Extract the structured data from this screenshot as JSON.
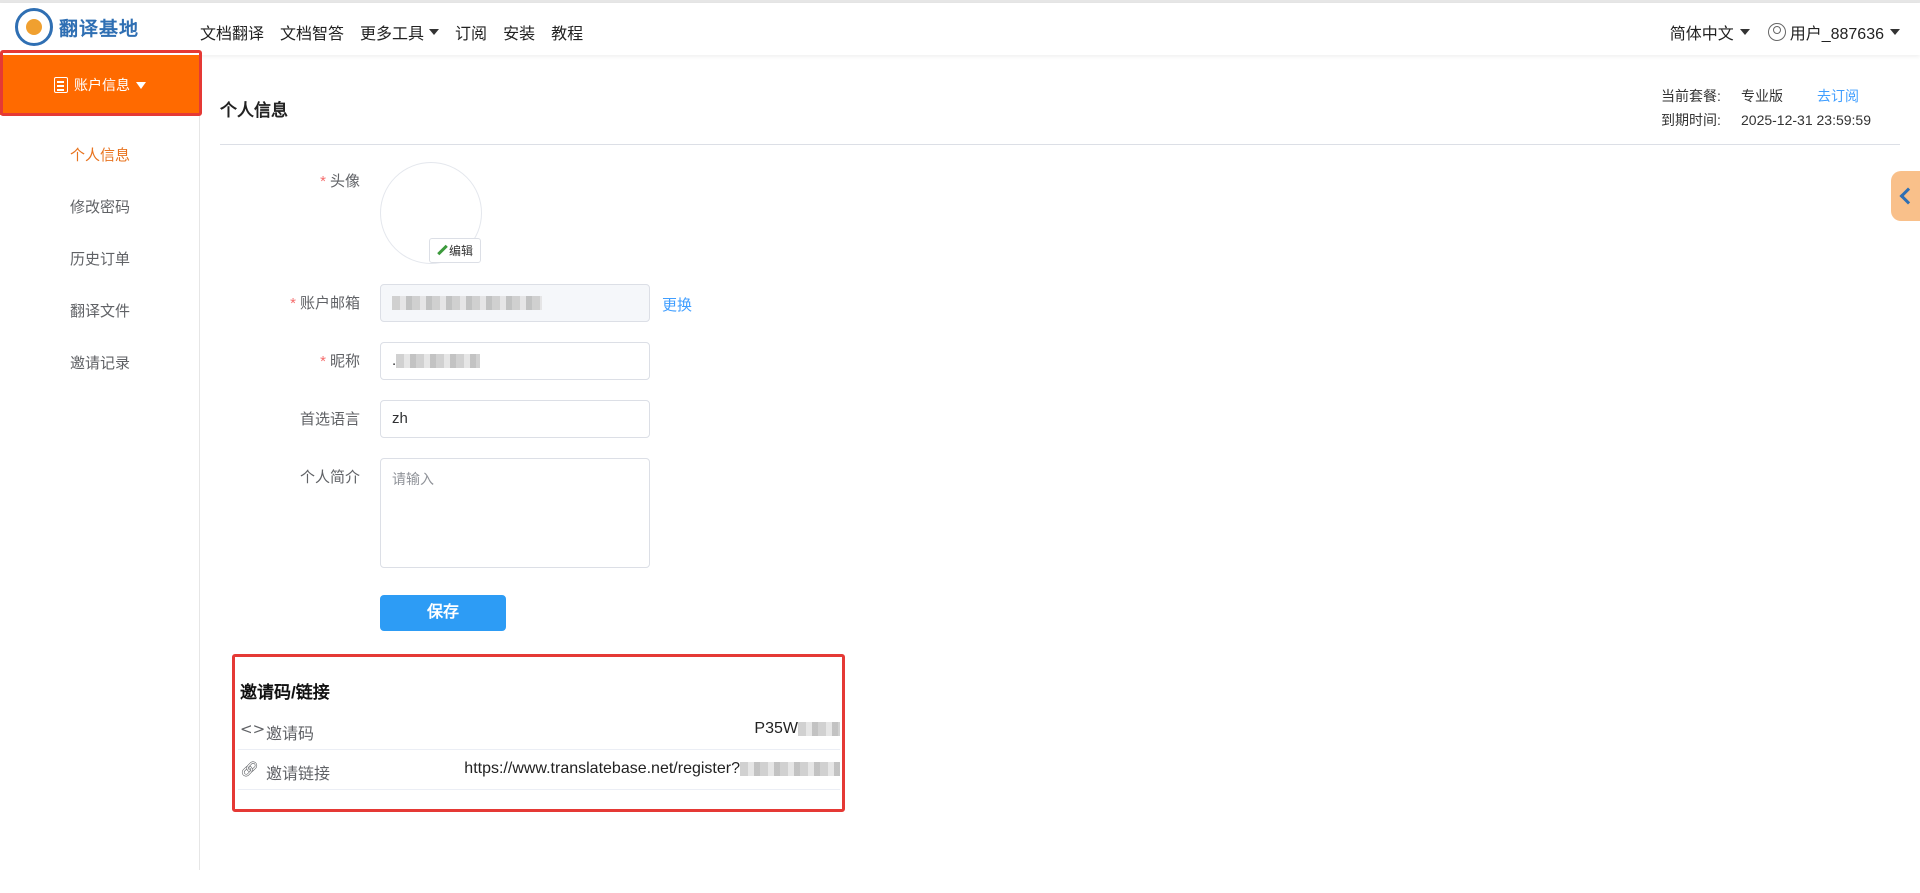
{
  "brand": {
    "name": "翻译基地"
  },
  "nav": {
    "items": [
      {
        "label": "文档翻译",
        "has_dropdown": false
      },
      {
        "label": "文档智答",
        "has_dropdown": false
      },
      {
        "label": "更多工具",
        "has_dropdown": true
      },
      {
        "label": "订阅",
        "has_dropdown": false
      },
      {
        "label": "安装",
        "has_dropdown": false
      },
      {
        "label": "教程",
        "has_dropdown": false
      }
    ]
  },
  "header_right": {
    "language": "简体中文",
    "username": "用户_887636"
  },
  "sidebar": {
    "account_button": "账户信息",
    "items": [
      {
        "label": "个人信息",
        "active": true
      },
      {
        "label": "修改密码",
        "active": false
      },
      {
        "label": "历史订单",
        "active": false
      },
      {
        "label": "翻译文件",
        "active": false
      },
      {
        "label": "邀请记录",
        "active": false
      }
    ]
  },
  "page": {
    "title": "个人信息"
  },
  "plan": {
    "plan_label": "当前套餐:",
    "plan_value": "专业版",
    "subscribe_link": "去订阅",
    "expire_label": "到期时间:",
    "expire_value": "2025-12-31 23:59:59"
  },
  "form": {
    "required_mark": "*",
    "avatar_label": "头像",
    "edit_button": "编辑",
    "email_label": "账户邮箱",
    "email_value_visible": "",
    "change_link": "更换",
    "nickname_label": "昵称",
    "nickname_value_visible": ".",
    "language_label": "首选语言",
    "language_value": "zh",
    "bio_label": "个人简介",
    "bio_placeholder": "请输入",
    "save_button": "保存"
  },
  "invite": {
    "title": "邀请码/链接",
    "code_label": "邀请码",
    "code_value_visible": "P35W",
    "link_label": "邀请链接",
    "link_value_visible": "https://www.translatebase.net/register?"
  },
  "colors": {
    "accent_orange": "#ff6a00",
    "active_menu": "#e8731e",
    "link_blue": "#409eff",
    "save_blue": "#2d9cf5",
    "brand_blue": "#2f6fb3",
    "annotation_red": "#e53935",
    "side_tab": "#f9c08a"
  }
}
